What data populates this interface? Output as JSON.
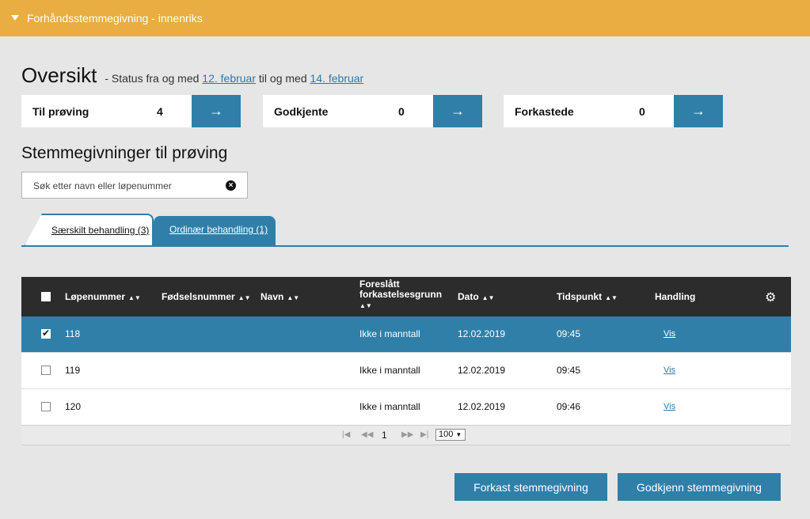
{
  "header": {
    "title": "Forhåndsstemmegivning - innenriks",
    "collapse_icon": "triangle-down-icon"
  },
  "overview": {
    "title": "Oversikt",
    "status_prefix": "- Status fra og med",
    "date_from": "12. februar",
    "status_mid": "til og med",
    "date_to": "14. februar"
  },
  "cards": [
    {
      "label": "Til prøving",
      "count": "4",
      "icon": "arrow-right-icon"
    },
    {
      "label": "Godkjente",
      "count": "0",
      "icon": "arrow-right-icon"
    },
    {
      "label": "Forkastede",
      "count": "0",
      "icon": "arrow-right-icon"
    }
  ],
  "section_title": "Stemmegivninger til prøving",
  "search": {
    "placeholder": "Søk etter navn eller løpenummer",
    "value": ""
  },
  "tabs": [
    {
      "label": "Særskilt behandling (3)",
      "active": true
    },
    {
      "label": "Ordinær behandling (1)",
      "active": false
    }
  ],
  "table": {
    "columns": [
      "Løpenummer",
      "Fødselsnummer",
      "Navn",
      "Foreslått forkastelsesgrunn",
      "Dato",
      "Tidspunkt",
      "Handling"
    ],
    "rows": [
      {
        "checked": true,
        "lopenummer": "118",
        "fodselsnummer": "",
        "navn": "",
        "grunn": "Ikke i manntall",
        "dato": "12.02.2019",
        "tid": "09:45",
        "handling": "Vis"
      },
      {
        "checked": false,
        "lopenummer": "119",
        "fodselsnummer": "",
        "navn": "",
        "grunn": "Ikke i manntall",
        "dato": "12.02.2019",
        "tid": "09:45",
        "handling": "Vis"
      },
      {
        "checked": false,
        "lopenummer": "120",
        "fodselsnummer": "",
        "navn": "",
        "grunn": "Ikke i manntall",
        "dato": "12.02.2019",
        "tid": "09:46",
        "handling": "Vis"
      }
    ],
    "pager": {
      "page": "1",
      "page_size": "100"
    }
  },
  "actions": {
    "reject": "Forkast stemmegivning",
    "approve": "Godkjenn stemmegivning"
  },
  "colors": {
    "header": "#e9ad41",
    "accent": "#2f7fa9",
    "table_head": "#2c2c2c",
    "background": "#e6e6e6"
  }
}
